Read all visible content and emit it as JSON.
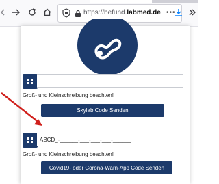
{
  "browser": {
    "url_prefix": "https://befund.",
    "url_domain": "labmed.de",
    "page_actions": "•••",
    "icons": [
      "back-icon",
      "forward-icon",
      "reload-icon",
      "home-icon",
      "shield-icon",
      "lock-icon",
      "download-icon",
      "overflow-icon"
    ]
  },
  "form": {
    "section1": {
      "input_value": "",
      "hint": "Groß- und Kleinschreibung beachten!",
      "button_label": "Skylab Code Senden"
    },
    "section2": {
      "input_value": "ABCD_-______-___-___-___-______",
      "hint": "Groß- und Kleinschreibung beachten!",
      "button_label": "Covid19- oder Corona-Warn-App Code Senden"
    }
  },
  "colors": {
    "primary": "#1c3a6b",
    "annotation_arrow": "#d0201c"
  }
}
